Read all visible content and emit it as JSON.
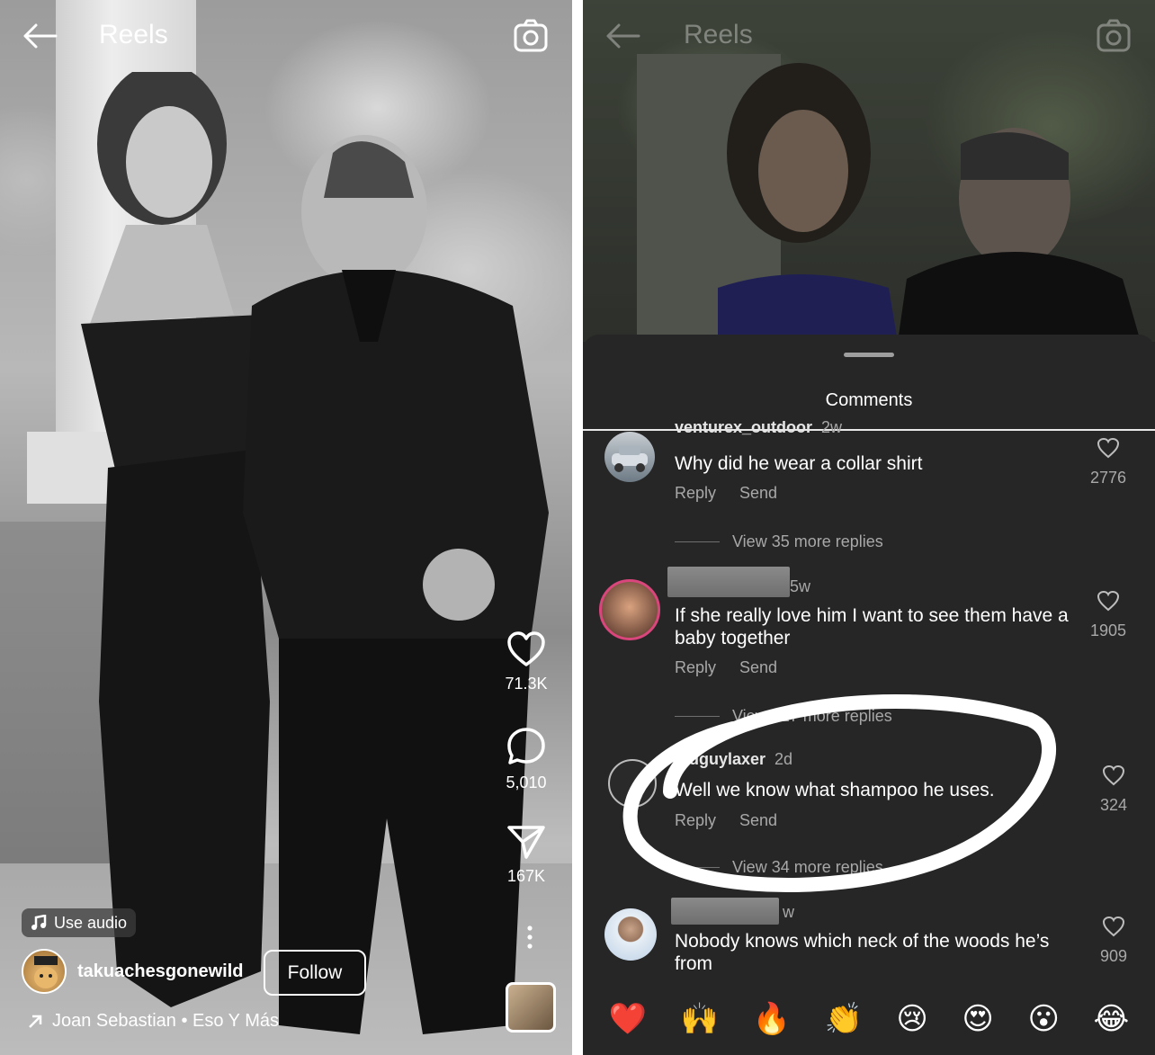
{
  "left": {
    "header": {
      "title": "Reels"
    },
    "actions": {
      "likes": "71.3K",
      "comments": "5,010",
      "shares": "167K"
    },
    "use_audio_label": "Use audio",
    "username": "takuachesgonewild",
    "follow_label": "Follow",
    "song": "Joan Sebastian • Eso Y Más"
  },
  "right": {
    "header": {
      "title": "Reels"
    },
    "sheet_title": "Comments",
    "comments": [
      {
        "username": "venturex_outdoor",
        "time": "2w",
        "text": "Why did he wear a collar shirt",
        "reply": "Reply",
        "send": "Send",
        "likes": "2776",
        "view_more": "View 35 more replies"
      },
      {
        "username": "",
        "time": "5w",
        "text": "If she really love him I want to see them have a baby together",
        "reply": "Reply",
        "send": "Send",
        "likes": "1905",
        "view_more": "View 127 more replies"
      },
      {
        "username": "oldguylaxer",
        "time": "2d",
        "text": "Well we know what shampoo he uses.",
        "reply": "Reply",
        "send": "Send",
        "likes": "324",
        "view_more": "View 34 more replies"
      },
      {
        "username": "",
        "time": "w",
        "text": "Nobody knows which neck of the woods he’s from",
        "likes": "909"
      }
    ],
    "emoji_reactions": [
      "❤️",
      "🙌",
      "🔥",
      "👏",
      "😢",
      "😍",
      "😮",
      "😂"
    ]
  }
}
